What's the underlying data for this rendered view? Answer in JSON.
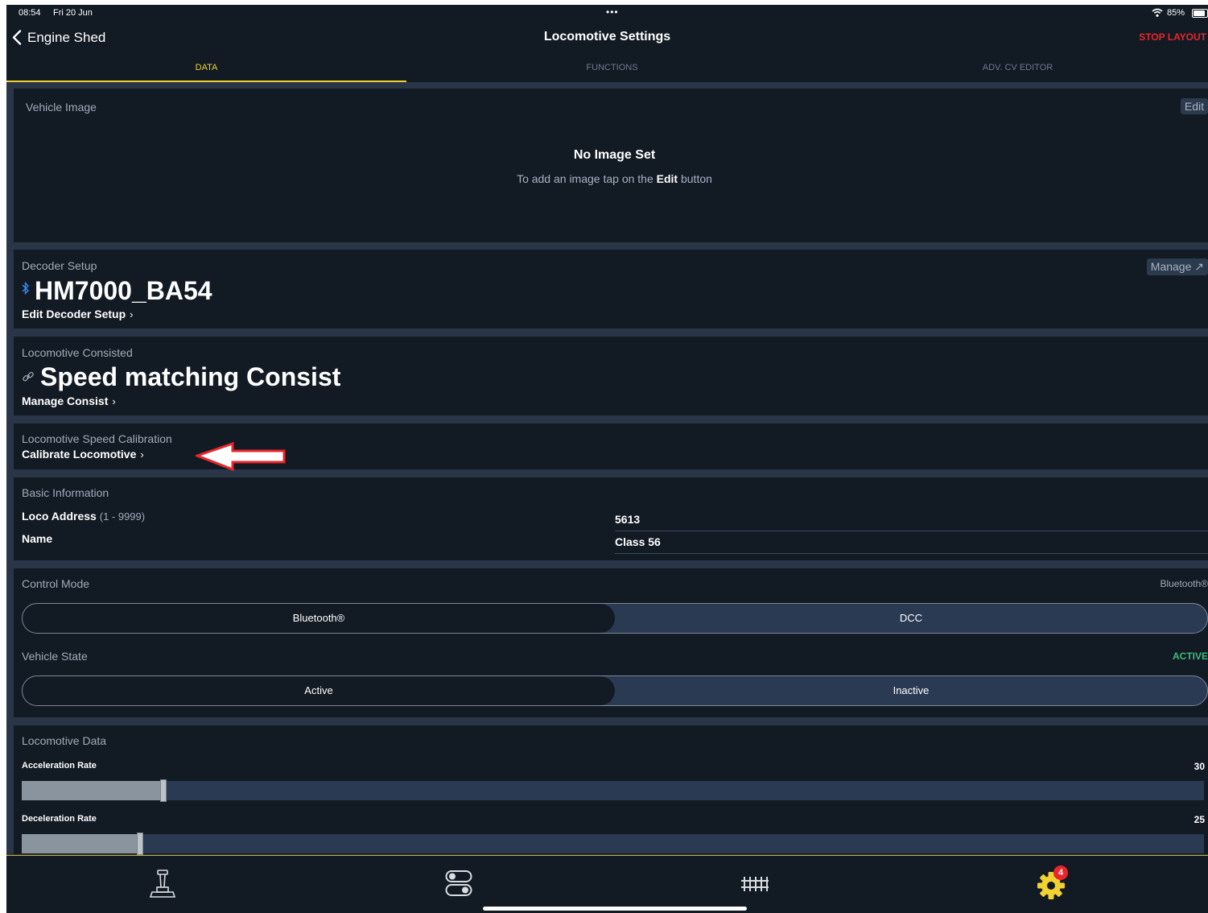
{
  "status": {
    "time": "08:54",
    "date": "Fri 20 Jun",
    "dots": "•••",
    "battery": "85%"
  },
  "nav": {
    "back_label": "Engine Shed",
    "title": "Locomotive Settings",
    "stop_label": "STOP LAYOUT"
  },
  "tabs": [
    {
      "label": "DATA"
    },
    {
      "label": "FUNCTIONS"
    },
    {
      "label": "ADV. CV EDITOR"
    }
  ],
  "vehicle_image": {
    "title": "Vehicle Image",
    "edit_label": "Edit",
    "empty_title": "No Image Set",
    "hint_prefix": "To add an image tap on the ",
    "hint_bold": "Edit",
    "hint_suffix": " button"
  },
  "decoder": {
    "title": "Decoder Setup",
    "manage_label": "Manage",
    "name": "HM7000_BA54",
    "edit_label": "Edit Decoder Setup"
  },
  "consist": {
    "title": "Locomotive Consisted",
    "name": "Speed matching Consist",
    "manage_label": "Manage Consist"
  },
  "calibration": {
    "title": "Locomotive Speed Calibration",
    "action_label": "Calibrate Locomotive"
  },
  "basic": {
    "title": "Basic Information",
    "address_label": "Loco Address",
    "address_range": "(1 - 9999)",
    "address_value": "5613",
    "name_label": "Name",
    "name_value": "Class 56"
  },
  "control_mode": {
    "title": "Control Mode",
    "current": "Bluetooth®",
    "options": [
      "Bluetooth®",
      "DCC"
    ]
  },
  "vehicle_state": {
    "title": "Vehicle State",
    "current": "ACTIVE",
    "options": [
      "Active",
      "Inactive"
    ]
  },
  "loco_data": {
    "title": "Locomotive Data",
    "accel_label": "Acceleration Rate",
    "accel_value": "30",
    "decel_label": "Deceleration Rate",
    "decel_value": "25"
  },
  "bottom_tabs": {
    "settings_badge": "4"
  },
  "colors": {
    "accent": "#f2d230",
    "stop": "#e8262b",
    "active_green": "#3bbf7a",
    "bluetooth_blue": "#2f8cff",
    "background": "#121a24"
  }
}
